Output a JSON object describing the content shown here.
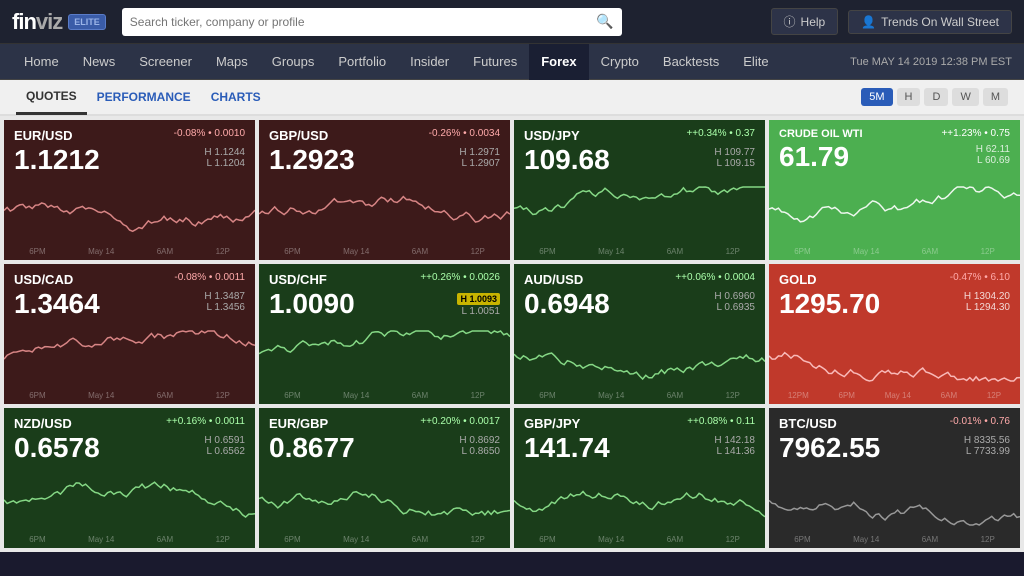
{
  "header": {
    "logo": "finviz",
    "elite_badge": "ELITE",
    "search_placeholder": "Search ticker, company or profile",
    "help_label": "Help",
    "trends_label": "Trends On Wall Street",
    "datetime": "Tue MAY 14 2019 12:38 PM EST"
  },
  "nav": {
    "items": [
      {
        "label": "Home",
        "active": false
      },
      {
        "label": "News",
        "active": false
      },
      {
        "label": "Screener",
        "active": false
      },
      {
        "label": "Maps",
        "active": false
      },
      {
        "label": "Groups",
        "active": false
      },
      {
        "label": "Portfolio",
        "active": false
      },
      {
        "label": "Insider",
        "active": false
      },
      {
        "label": "Futures",
        "active": false
      },
      {
        "label": "Forex",
        "active": true
      },
      {
        "label": "Crypto",
        "active": false
      },
      {
        "label": "Backtests",
        "active": false
      },
      {
        "label": "Elite",
        "active": false
      }
    ]
  },
  "tabs": {
    "items": [
      {
        "label": "QUOTES",
        "active": true,
        "blue": false
      },
      {
        "label": "PERFORMANCE",
        "active": false,
        "blue": true
      },
      {
        "label": "CHARTS",
        "active": false,
        "blue": true
      }
    ],
    "time_buttons": [
      "5M",
      "H",
      "D",
      "W",
      "M"
    ],
    "active_time": "5M"
  },
  "tiles": [
    {
      "symbol": "EUR/USD",
      "change": "-0.08%",
      "dot": "•",
      "change_val": "0.0010",
      "price": "1.1212",
      "high": "H 1.1244",
      "low": "L 1.1204",
      "color": "dark-red",
      "positive": false,
      "time_labels": [
        "6PM",
        "May 14",
        "6AM",
        "12P"
      ]
    },
    {
      "symbol": "GBP/USD",
      "change": "-0.26%",
      "dot": "•",
      "change_val": "0.0034",
      "price": "1.2923",
      "high": "H 1.2971",
      "low": "L 1.2907",
      "color": "dark-red",
      "positive": false,
      "time_labels": [
        "6PM",
        "May 14",
        "6AM",
        "12P"
      ]
    },
    {
      "symbol": "USD/JPY",
      "change": "+0.34%",
      "dot": "•",
      "change_val": "0.37",
      "price": "109.68",
      "high": "H 109.77",
      "low": "L 109.15",
      "color": "dark-green",
      "positive": true,
      "time_labels": [
        "6PM",
        "May 14",
        "6AM",
        "12P"
      ]
    },
    {
      "symbol": "CRUDE OIL WTI",
      "change": "+1.23%",
      "dot": "•",
      "change_val": "0.75",
      "price": "61.79",
      "high": "H 62.11",
      "low": "L 60.69",
      "color": "bright-green",
      "positive": true,
      "time_labels": [
        "6PM",
        "May 14",
        "6AM",
        "12P"
      ]
    },
    {
      "symbol": "USD/CAD",
      "change": "-0.08%",
      "dot": "•",
      "change_val": "0.0011",
      "price": "1.3464",
      "high": "H 1.3487",
      "low": "L 1.3456",
      "color": "dark-red",
      "positive": false,
      "time_labels": [
        "6PM",
        "May 14",
        "6AM",
        "12P"
      ]
    },
    {
      "symbol": "USD/CHF",
      "change": "+0.26%",
      "dot": "•",
      "change_val": "0.0026",
      "price": "1.0090",
      "high": "H 1.0093",
      "low": "L 1.0051",
      "color": "dark-green",
      "positive": true,
      "highlight": "H 1.0093",
      "time_labels": [
        "6PM",
        "May 14",
        "6AM",
        "12P"
      ]
    },
    {
      "symbol": "AUD/USD",
      "change": "+0.06%",
      "dot": "•",
      "change_val": "0.0004",
      "price": "0.6948",
      "high": "H 0.6960",
      "low": "L 0.6935",
      "color": "dark-green",
      "positive": true,
      "time_labels": [
        "6PM",
        "May 14",
        "6AM",
        "12P"
      ]
    },
    {
      "symbol": "GOLD",
      "change": "-0.47%",
      "dot": "•",
      "change_val": "6.10",
      "price": "1295.70",
      "high": "H 1304.20",
      "low": "L 1294.30",
      "color": "bright-red",
      "positive": false,
      "time_labels": [
        "12PM",
        "6PM",
        "May 14",
        "6AM",
        "12P"
      ]
    },
    {
      "symbol": "NZD/USD",
      "change": "+0.16%",
      "dot": "•",
      "change_val": "0.0011",
      "price": "0.6578",
      "high": "H 0.6591",
      "low": "L 0.6562",
      "color": "dark-green",
      "positive": true,
      "time_labels": [
        "6PM",
        "May 14",
        "6AM",
        "12P"
      ]
    },
    {
      "symbol": "EUR/GBP",
      "change": "+0.20%",
      "dot": "•",
      "change_val": "0.0017",
      "price": "0.8677",
      "high": "H 0.8692",
      "low": "L 0.8650",
      "color": "dark-green",
      "positive": true,
      "time_labels": [
        "6PM",
        "May 14",
        "6AM",
        "12P"
      ]
    },
    {
      "symbol": "GBP/JPY",
      "change": "+0.08%",
      "dot": "•",
      "change_val": "0.11",
      "price": "141.74",
      "high": "H 142.18",
      "low": "L 141.36",
      "color": "dark-green",
      "positive": true,
      "time_labels": [
        "6PM",
        "May 14",
        "6AM",
        "12P"
      ]
    },
    {
      "symbol": "BTC/USD",
      "change": "-0.01%",
      "dot": "•",
      "change_val": "0.76",
      "price": "7962.55",
      "high": "H 8335.56",
      "low": "L 7733.99",
      "color": "dark-gray",
      "positive": false,
      "time_labels": [
        "6PM",
        "May 14",
        "6AM",
        "12P"
      ]
    }
  ]
}
